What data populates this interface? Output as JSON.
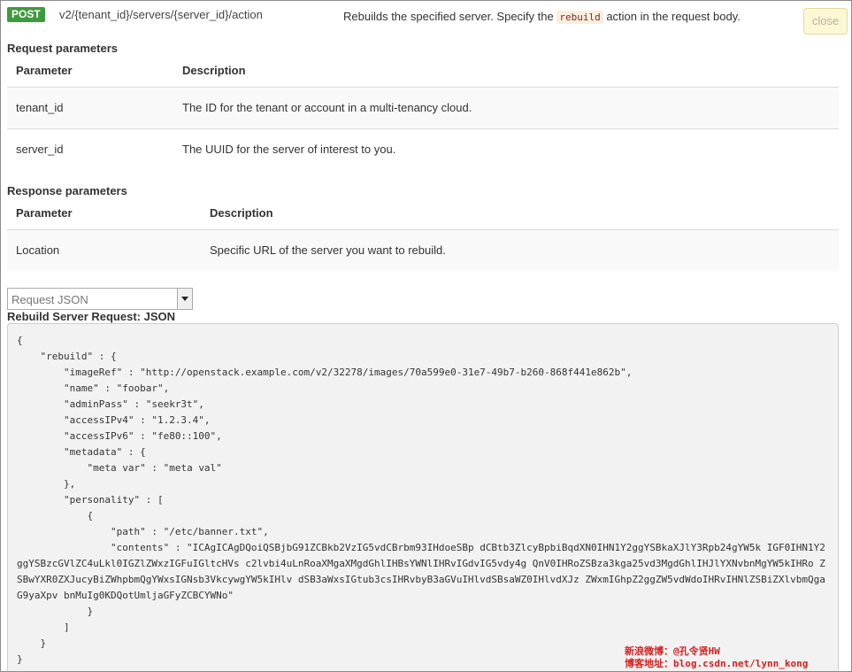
{
  "endpoint": {
    "method": "POST",
    "path": "v2/{tenant_id}/servers/{server_id}/action",
    "description_before": "Rebuilds the specified server. Specify the ",
    "description_code": "rebuild",
    "description_after": " action in the request body.",
    "close_label": "close"
  },
  "request_params": {
    "title": "Request parameters",
    "headers": [
      "Parameter",
      "Description"
    ],
    "rows": [
      {
        "param": "tenant_id",
        "desc": "The ID for the tenant or account in a multi-tenancy cloud."
      },
      {
        "param": "server_id",
        "desc": "The UUID for the server of interest to you."
      }
    ]
  },
  "response_params": {
    "title": "Response parameters",
    "headers": [
      "Parameter",
      "Description"
    ],
    "rows": [
      {
        "param": "Location",
        "desc": "Specific URL of the server you want to rebuild."
      }
    ]
  },
  "sample_select": {
    "value": "Request JSON"
  },
  "sample": {
    "title": "Rebuild Server Request: JSON",
    "code": "{\n    \"rebuild\" : {\n        \"imageRef\" : \"http://openstack.example.com/v2/32278/images/70a599e0-31e7-49b7-b260-868f441e862b\",\n        \"name\" : \"foobar\",\n        \"adminPass\" : \"seekr3t\",\n        \"accessIPv4\" : \"1.2.3.4\",\n        \"accessIPv6\" : \"fe80::100\",\n        \"metadata\" : {\n            \"meta var\" : \"meta val\"\n        },\n        \"personality\" : [\n            {\n                \"path\" : \"/etc/banner.txt\",\n                \"contents\" : \"ICAgICAgDQoiQSBjbG91ZCBkb2VzIG5vdCBrbm93IHdoeSBp dCBtb3ZlcyBpbiBqdXN0IHN1Y2ggYSBkaXJlY3Rpb24gYW5k IGF0IHN1Y2ggYSBzcGVlZC4uLkl0IGZlZWxzIGFuIGltcHVs c2lvbi4uLnRoaXMgaXMgdGhlIHBsYWNlIHRvIGdvIG5vdy4g QnV0IHRoZSBza3kga25vd3MgdGhlIHJlYXNvbnMgYW5kIHRo ZSBwYXR0ZXJucyBiZWhpbmQgYWxsIGNsb3VkcywgYW5kIHlv dSB3aWxsIGtub3csIHRvbyB3aGVuIHlvdSBsaWZ0IHlvdXJz ZWxmIGhpZ2ggZW5vdWdoIHRvIHNlZSBiZXlvbmQgaG9yaXpv bnMuIg0KDQotUmljaGFyZCBCYWNo\"\n            }\n        ]\n    }\n}"
  },
  "watermark": {
    "line1": "新浪微博：@孔令贤HW",
    "line2": "博客地址：blog.csdn.net/lynn_kong"
  },
  "colors": {
    "post_badge": "#3e9a3e",
    "close_button_bg": "#fcf8d4",
    "code_bg": "#f2f2f2",
    "watermark": "#d62020"
  }
}
